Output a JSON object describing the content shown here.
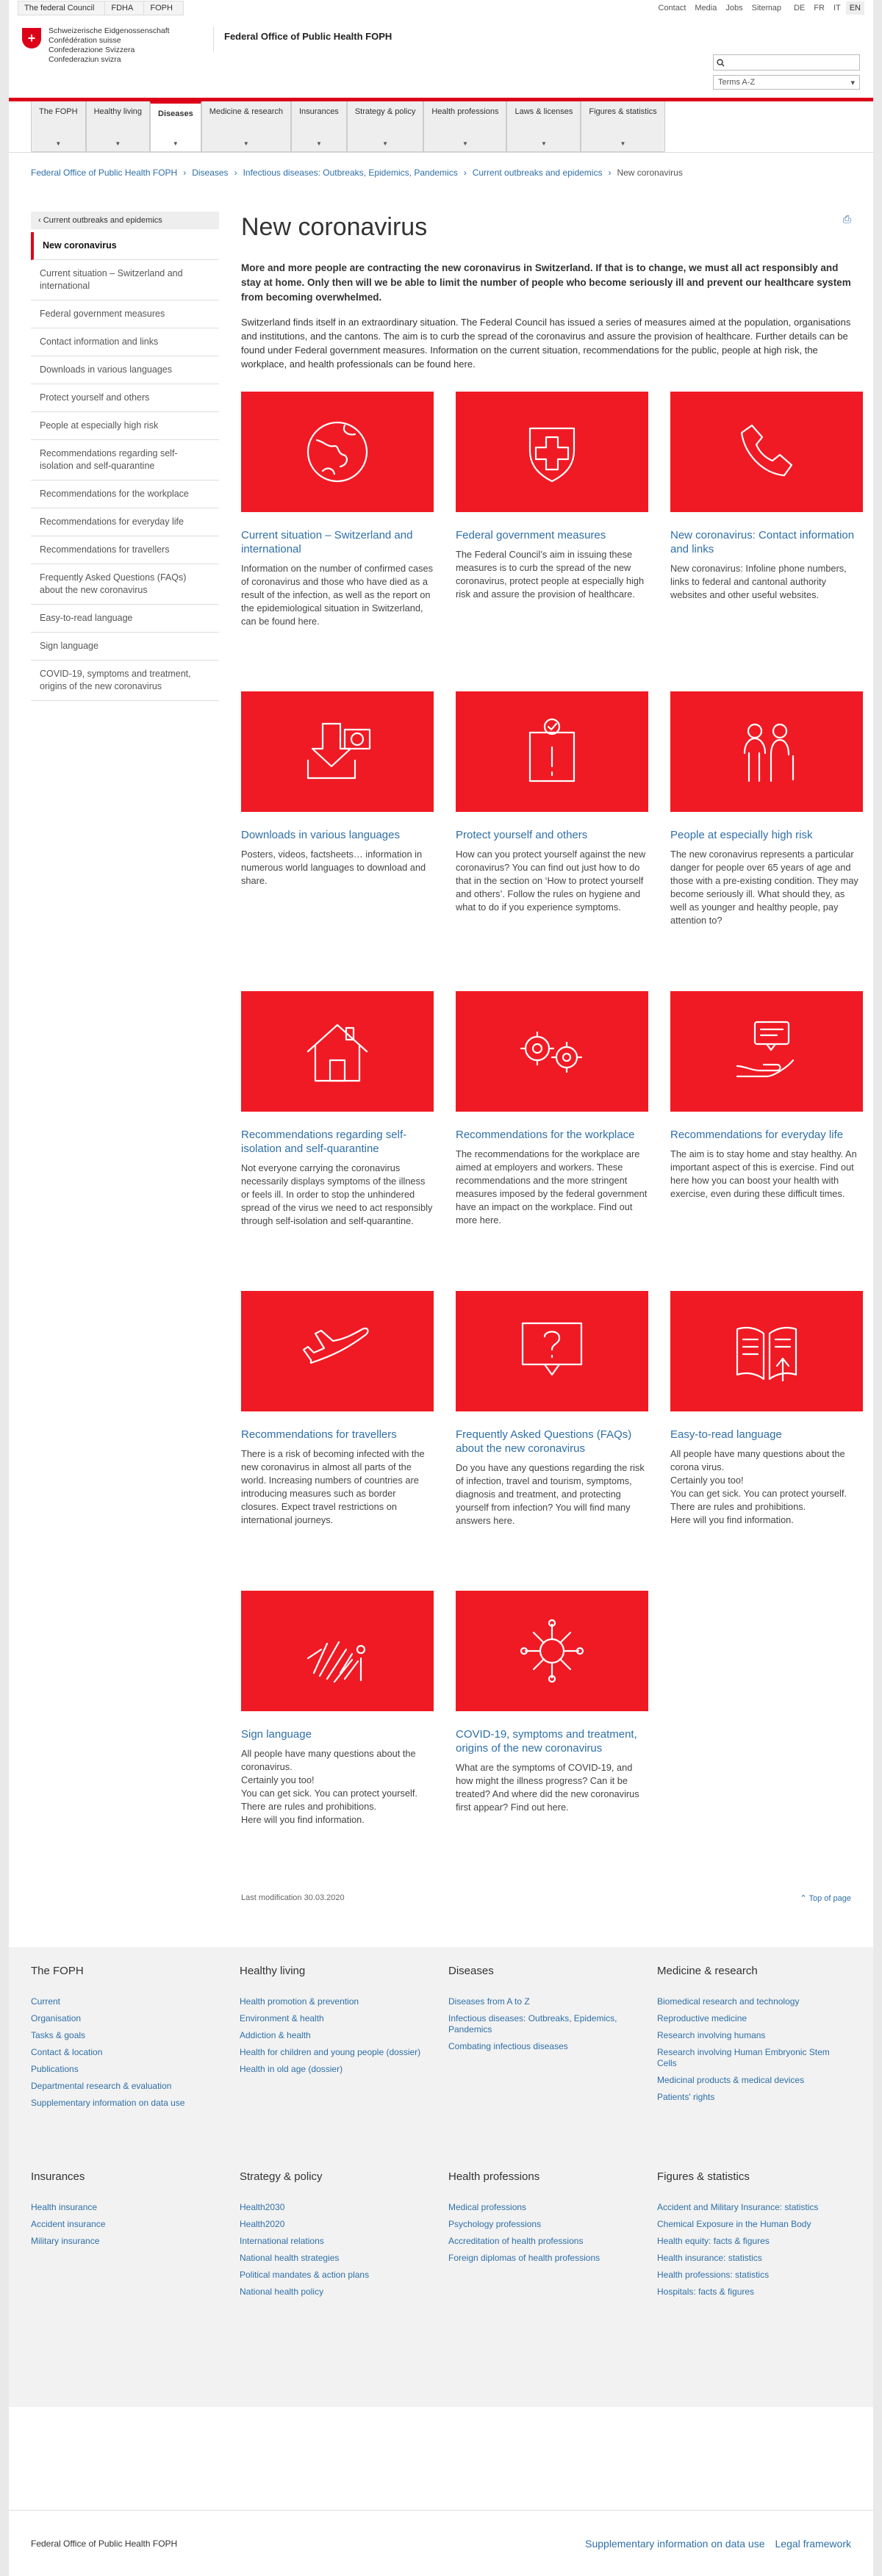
{
  "topbar": {
    "crumbs": [
      "The federal Council",
      "FDHA",
      "FOPH"
    ],
    "utility": [
      "Contact",
      "Media",
      "Jobs",
      "Sitemap"
    ],
    "langs": [
      "DE",
      "FR",
      "IT",
      "EN"
    ],
    "active_lang": "EN"
  },
  "header": {
    "conf": [
      "Schweizerische Eidgenossenschaft",
      "Confédération suisse",
      "Confederazione Svizzera",
      "Confederaziun svizra"
    ],
    "title": "Federal Office of Public Health FOPH",
    "terms": "Terms A-Z"
  },
  "nav": [
    "The FOPH",
    "Healthy living",
    "Diseases",
    "Medicine & research",
    "Insurances",
    "Strategy & policy",
    "Health professions",
    "Laws & licenses",
    "Figures & statistics"
  ],
  "nav_active": "Diseases",
  "path": [
    "Federal Office of Public Health FOPH",
    "Diseases",
    "Infectious diseases: Outbreaks, Epidemics, Pandemics",
    "Current outbreaks and epidemics",
    "New coronavirus"
  ],
  "side": {
    "back": "Current outbreaks and epidemics",
    "items": [
      "New coronavirus",
      "Current situation – Switzerland and international",
      "Federal government measures",
      "Contact information and links",
      "Downloads in various languages",
      "Protect yourself and others",
      "People at especially high risk",
      "Recommendations regarding self-isolation and self-quarantine",
      "Recommendations for the workplace",
      "Recommendations for everyday life",
      "Recommendations for travellers",
      "Frequently Asked Questions (FAQs) about the new coronavirus",
      "Easy-to-read language",
      "Sign language",
      "COVID-19, symptoms and treatment, origins of the new coronavirus"
    ]
  },
  "content": {
    "title": "New coronavirus",
    "lead": "More and more people are contracting the new coronavirus in Switzerland. If that is to change, we must all act responsibly and stay at home. Only then will we be able to limit the number of people who become seriously ill and prevent our healthcare system from becoming overwhelmed.",
    "intro": "Switzerland finds itself in an extraordinary situation. The Federal Council has issued a series of measures aimed at the population, organisations and institutions, and the cantons. The aim is to curb the spread of the coronavirus and assure the provision of healthcare. Further details can be found under Federal government measures. Information on the current situation, recommendations for the public, people at high risk, the workplace, and health professionals can be found here.",
    "cards": [
      {
        "icon": "globe-icon",
        "title": "Current situation – Switzerland and international",
        "text": "Information on the number of confirmed cases of coronavirus and those who have died as a result of the infection, as well as the report on the epidemiological situation in Switzerland, can be found here."
      },
      {
        "icon": "swiss-shield-icon",
        "title": "Federal government measures",
        "text": "The Federal Council’s aim in issuing these measures is to curb the spread of the new coronavirus, protect people at especially high risk and assure the provision of healthcare."
      },
      {
        "icon": "phone-icon",
        "title": "New coronavirus: Contact information and links",
        "text": "New coronavirus: Infoline phone numbers, links to federal and cantonal authority websites and other useful websites."
      },
      {
        "icon": "download-icon",
        "title": "Downloads in various languages",
        "text": "Posters, videos, factsheets… information in numerous world languages to download and share."
      },
      {
        "icon": "warning-sign-icon",
        "title": "Protect yourself and others",
        "text": "How can you protect yourself against the new coronavirus? You can find out just how to do that in the section on ‘How to protect yourself and others’. Follow the rules on hygiene and what to do if you experience symptoms."
      },
      {
        "icon": "people-icon",
        "title": "People at especially high risk",
        "text": "The new coronavirus represents a particular danger for people over 65 years of age and those with a pre-existing condition. They may become seriously ill. What should they, as well as younger and healthy people, pay attention to?"
      },
      {
        "icon": "house-icon",
        "title": "Recommendations regarding self-isolation and self-quarantine",
        "text": "Not everyone carrying the coronavirus necessarily displays symptoms of the illness or feels ill. In order to stop the unhindered spread of the virus we need to act responsibly through self-isolation and self-quarantine."
      },
      {
        "icon": "gears-icon",
        "title": "Recommendations for the workplace",
        "text": "The recommendations for the workplace are aimed at employers and workers. These recommendations and the more stringent measures imposed by the federal government have an impact on the workplace. Find out more here."
      },
      {
        "icon": "hand-message-icon",
        "title": "Recommendations for everyday life",
        "text": "The aim is to stay home and stay healthy. An important aspect of this is exercise. Find out here how you can boost your health with exercise, even during these difficult times."
      },
      {
        "icon": "airplane-icon",
        "title": "Recommendations for travellers",
        "text": "There is a risk of becoming infected with the new coronavirus in almost all parts of the world. Increasing numbers of countries are introducing measures such as border closures. Expect travel restrictions on international journeys."
      },
      {
        "icon": "question-bubble-icon",
        "title": "Frequently Asked Questions (FAQs) about the new coronavirus",
        "text": "Do you have any questions regarding the risk of infection, travel and tourism, symptoms, diagnosis and treatment, and protecting yourself from infection? You will find many answers here."
      },
      {
        "icon": "easy-read-icon",
        "title": "Easy-to-read language",
        "text": "All people have many questions about the corona virus.\nCertainly you too!\nYou can get sick. You can protect yourself.\nThere are rules and prohibitions.\nHere will you find information."
      },
      {
        "icon": "sign-language-icon",
        "title": "Sign language",
        "text": "All people have many questions about the coronavirus.\nCertainly you too!\nYou can get sick. You can protect yourself.\nThere are rules and prohibitions.\nHere will you find information."
      },
      {
        "icon": "virus-icon",
        "title": "COVID-19, symptoms and treatment, origins of the new coronavirus",
        "text": "What are the symptoms of COVID-19, and how might the illness progress? Can it be treated? And where did the new coronavirus first appear? Find out here."
      }
    ],
    "lastmod": "Last modification 30.03.2020",
    "top": "Top of page"
  },
  "footer": {
    "cols": [
      {
        "h": "The FOPH",
        "links": [
          "Current",
          "Organisation",
          "Tasks & goals",
          "Contact & location",
          "Publications",
          "Departmental research & evaluation",
          "Supplementary information on data use"
        ]
      },
      {
        "h": "Healthy living",
        "links": [
          "Health promotion & prevention",
          "Environment & health",
          "Addiction & health",
          "Health for children and young people (dossier)",
          "Health in old age (dossier)"
        ]
      },
      {
        "h": "Diseases",
        "links": [
          "Diseases from A to Z",
          "Infectious diseases: Outbreaks, Epidemics, Pandemics",
          "Combating infectious diseases"
        ]
      },
      {
        "h": "Medicine & research",
        "links": [
          "Biomedical research and technology",
          "Reproductive medicine",
          "Research involving humans",
          "Research involving Human Embryonic Stem Cells",
          "Medicinal products & medical devices",
          "Patients' rights"
        ]
      },
      {
        "h": "Insurances",
        "links": [
          "Health insurance",
          "Accident insurance",
          "Military insurance"
        ]
      },
      {
        "h": "Strategy & policy",
        "links": [
          "Health2030",
          "Health2020",
          "International relations",
          "National health strategies",
          "Political mandates & action plans",
          "National health policy"
        ]
      },
      {
        "h": "Health professions",
        "links": [
          "Medical professions",
          "Psychology professions",
          "Accreditation of health professions",
          "Foreign diplomas of health professions"
        ]
      },
      {
        "h": "Figures & statistics",
        "links": [
          "Accident and Military Insurance: statistics",
          "Chemical Exposure in the Human Body",
          "Health equity: facts & figures",
          "Health insurance: statistics",
          "Health professions: statistics",
          "Hospitals: facts & figures"
        ]
      }
    ],
    "bottom_left": "Federal Office of Public Health FOPH",
    "bottom_links": [
      "Supplementary information on data use",
      "Legal framework"
    ]
  }
}
